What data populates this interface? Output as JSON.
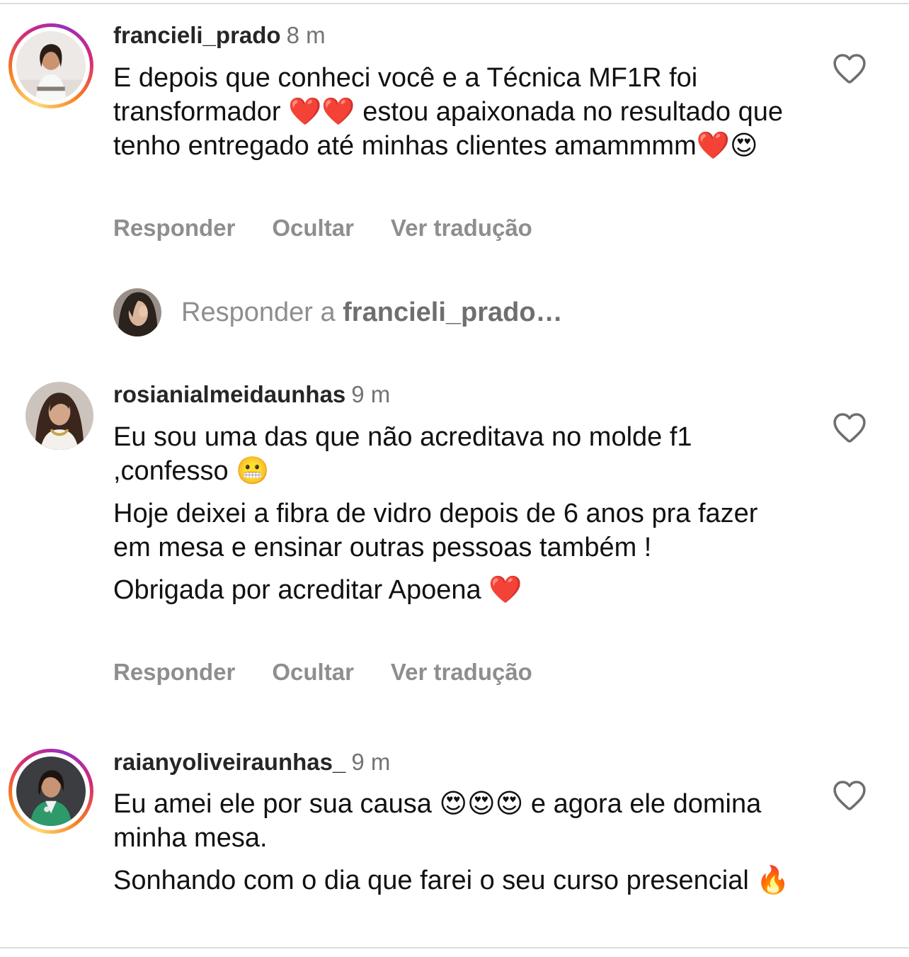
{
  "comments": [
    {
      "username": "francieli_prado",
      "time": "8 m",
      "lines": [
        "E depois que conheci você e a Técnica MF1R foi transformador ❤️❤️ estou apaixonada no resultado que tenho entregado até minhas clientes amammmm❤️😍"
      ],
      "actions": [
        "Responder",
        "Ocultar",
        "Ver tradução"
      ],
      "avatar": "woman-white-blazer-avatar",
      "story_ring": true
    },
    {
      "username": "rosianialmeidaunhas",
      "time": "9 m",
      "lines": [
        "Eu sou uma das que não acreditava no molde f1 ,confesso 😬",
        "Hoje deixei a fibra de vidro depois de 6 anos pra fazer em mesa e ensinar outras pessoas também !",
        "Obrigada por acreditar Apoena ❤️"
      ],
      "actions": [
        "Responder",
        "Ocultar",
        "Ver tradução"
      ],
      "avatar": "woman-necklace-avatar",
      "story_ring": false
    },
    {
      "username": "raianyoliveiraunhas_",
      "time": "9 m",
      "lines": [
        "Eu amei ele por sua causa 😍😍😍 e agora ele domina minha mesa.",
        "Sonhando com o dia que farei o seu curso presencial 🔥"
      ],
      "avatar": "woman-green-blazer-avatar",
      "story_ring": true
    }
  ],
  "reply": {
    "prefix": "Responder a ",
    "target": "francieli_prado…"
  },
  "icons": {
    "like": "heart-outline-icon"
  },
  "colors": {
    "username": "#262626",
    "muted": "#8e8e8e",
    "divider": "#dcdcdc"
  }
}
